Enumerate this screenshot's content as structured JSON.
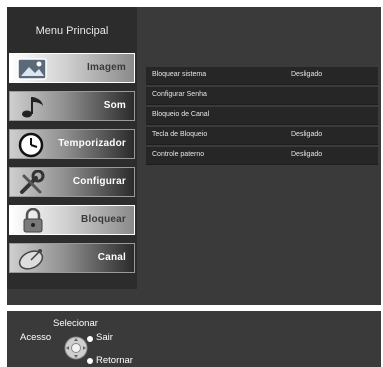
{
  "sidebar": {
    "title": "Menu Principal",
    "items": [
      {
        "label": "Imagem",
        "icon": "image-icon",
        "selected": true
      },
      {
        "label": "Som",
        "icon": "music-note-icon",
        "selected": false
      },
      {
        "label": "Temporizador",
        "icon": "clock-icon",
        "selected": false
      },
      {
        "label": "Configurar",
        "icon": "tools-icon",
        "selected": false
      },
      {
        "label": "Bloquear",
        "icon": "padlock-icon",
        "selected": true
      },
      {
        "label": "Canal",
        "icon": "satellite-dish-icon",
        "selected": false
      }
    ]
  },
  "settings": {
    "rows": [
      {
        "name": "Bloquear sistema",
        "value": "Desligado"
      },
      {
        "name": "Configurar Senha",
        "value": ""
      },
      {
        "name": "Bloqueio de Canal",
        "value": ""
      },
      {
        "name": "Tecla de Bloqueio",
        "value": "Desligado"
      },
      {
        "name": "Controle paterno",
        "value": "Desligado"
      }
    ]
  },
  "footer": {
    "select_label": "Selecionar",
    "access_label": "Acesso",
    "exit_label": "Sair",
    "return_label": "Retornar"
  }
}
